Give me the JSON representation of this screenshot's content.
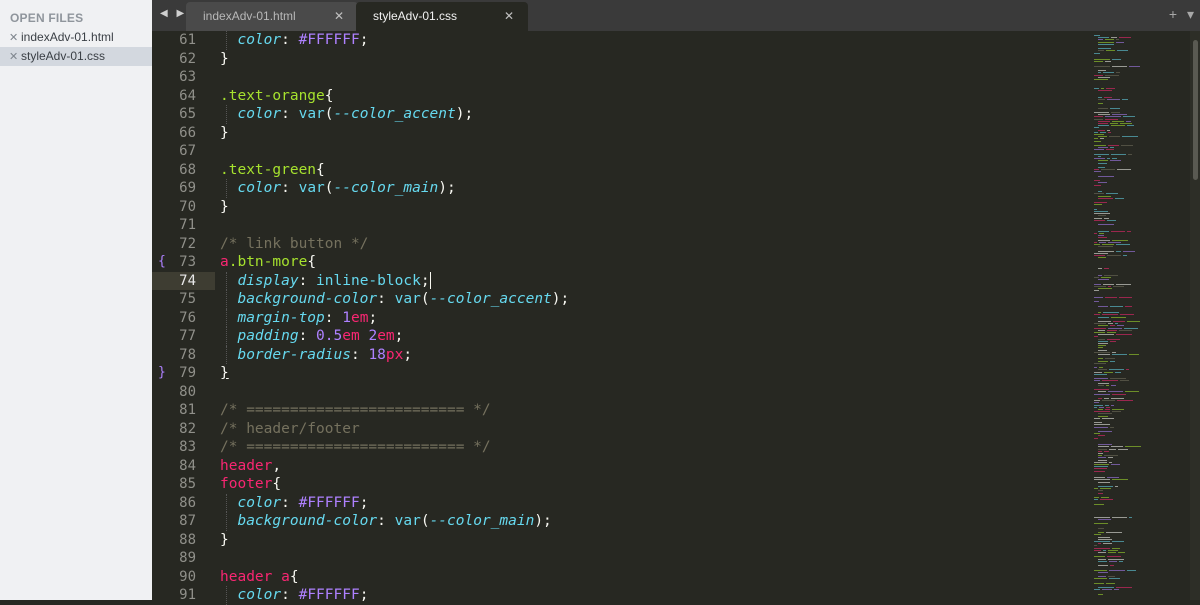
{
  "sidebar": {
    "header": "OPEN FILES",
    "files": [
      {
        "close_glyph": "✕",
        "name": "indexAdv-01.html"
      },
      {
        "close_glyph": "✕",
        "name": "styleAdv-01.css"
      }
    ]
  },
  "tabbar": {
    "nav_arrows": "◀ ▶",
    "tabs": [
      {
        "label": "indexAdv-01.html",
        "close_glyph": "✕"
      },
      {
        "label": "styleAdv-01.css",
        "close_glyph": "✕"
      }
    ],
    "new_tab_glyph": "+",
    "menu_glyph": "▾"
  },
  "editor": {
    "active_line": "74",
    "fold_open": "{",
    "fold_close": "}",
    "line_numbers": [
      "61",
      "62",
      "63",
      "64",
      "65",
      "66",
      "67",
      "68",
      "69",
      "70",
      "71",
      "72",
      "73",
      "74",
      "75",
      "76",
      "77",
      "78",
      "79",
      "80",
      "81",
      "82",
      "83",
      "84",
      "85",
      "86",
      "87",
      "88",
      "89",
      "90",
      "91"
    ]
  },
  "colors": {
    "background": "#272822",
    "selector": "#a6e22e",
    "tag": "#f92672",
    "property": "#66d9ef",
    "number": "#ae81ff",
    "comment": "#75715e"
  }
}
